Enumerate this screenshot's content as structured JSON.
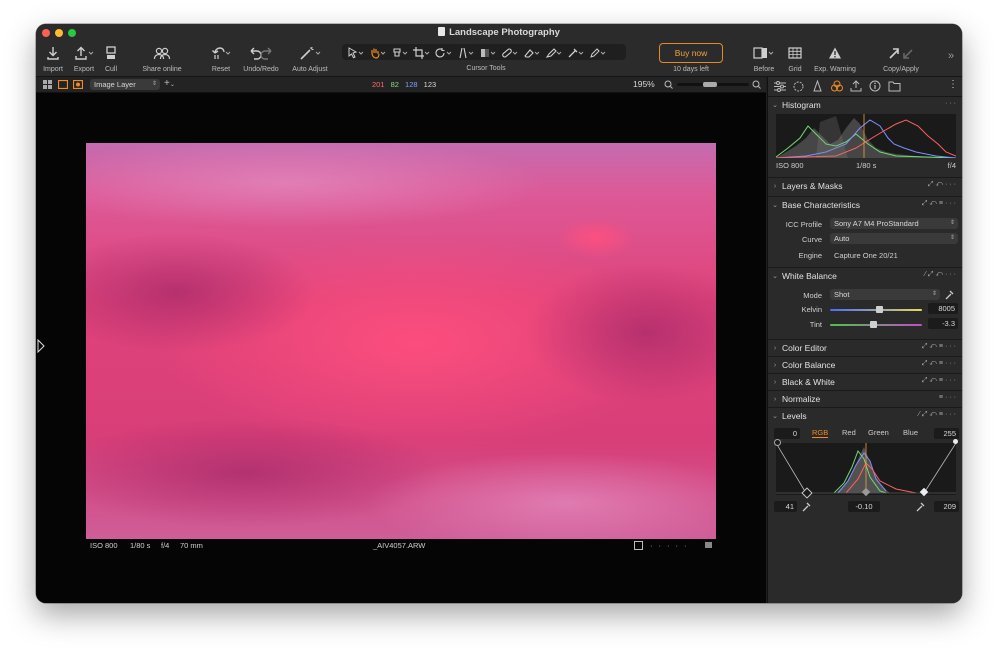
{
  "window": {
    "title": "Landscape Photography"
  },
  "toolbar": {
    "import": "Import",
    "export": "Export",
    "cull": "Cull",
    "share": "Share online",
    "reset": "Reset",
    "undo_redo": "Undo/Redo",
    "auto_adjust": "Auto Adjust",
    "cursor_tools": "Cursor Tools",
    "buy_now": "Buy now",
    "trial_left": "10 days left",
    "before": "Before",
    "grid": "Grid",
    "exp_warning": "Exp. Warning",
    "copy_apply": "Copy/Apply"
  },
  "subbar": {
    "layer": "Image Layer",
    "rgb": {
      "r": "201",
      "g": "82",
      "b": "128",
      "l": "123"
    },
    "zoom": "195%"
  },
  "infobar": {
    "iso": "ISO 800",
    "shutter": "1/80 s",
    "aperture": "f/4",
    "focal": "70 mm",
    "filename": "_AIV4057.ARW"
  },
  "histogram": {
    "title": "Histogram",
    "iso": "ISO 800",
    "shutter": "1/80 s",
    "aperture": "f/4"
  },
  "sections": {
    "layers_masks": "Layers & Masks",
    "base_characteristics": "Base Characteristics",
    "white_balance": "White Balance",
    "color_editor": "Color Editor",
    "color_balance": "Color Balance",
    "black_white": "Black & White",
    "normalize": "Normalize",
    "levels": "Levels"
  },
  "base": {
    "icc_label": "ICC Profile",
    "icc_value": "Sony A7 M4 ProStandard",
    "curve_label": "Curve",
    "curve_value": "Auto",
    "engine_label": "Engine",
    "engine_value": "Capture One 20/21"
  },
  "white_balance": {
    "mode_label": "Mode",
    "mode_value": "Shot",
    "kelvin_label": "Kelvin",
    "kelvin_value": "8005",
    "tint_label": "Tint",
    "tint_value": "-3.3"
  },
  "levels": {
    "low_out": "0",
    "high_out": "255",
    "tabs": [
      "RGB",
      "Red",
      "Green",
      "Blue"
    ],
    "low_in": "41",
    "mid": "-0.10",
    "high_in": "209"
  },
  "colors": {
    "accent": "#f08a24",
    "photo_pink": "#e8457a"
  }
}
